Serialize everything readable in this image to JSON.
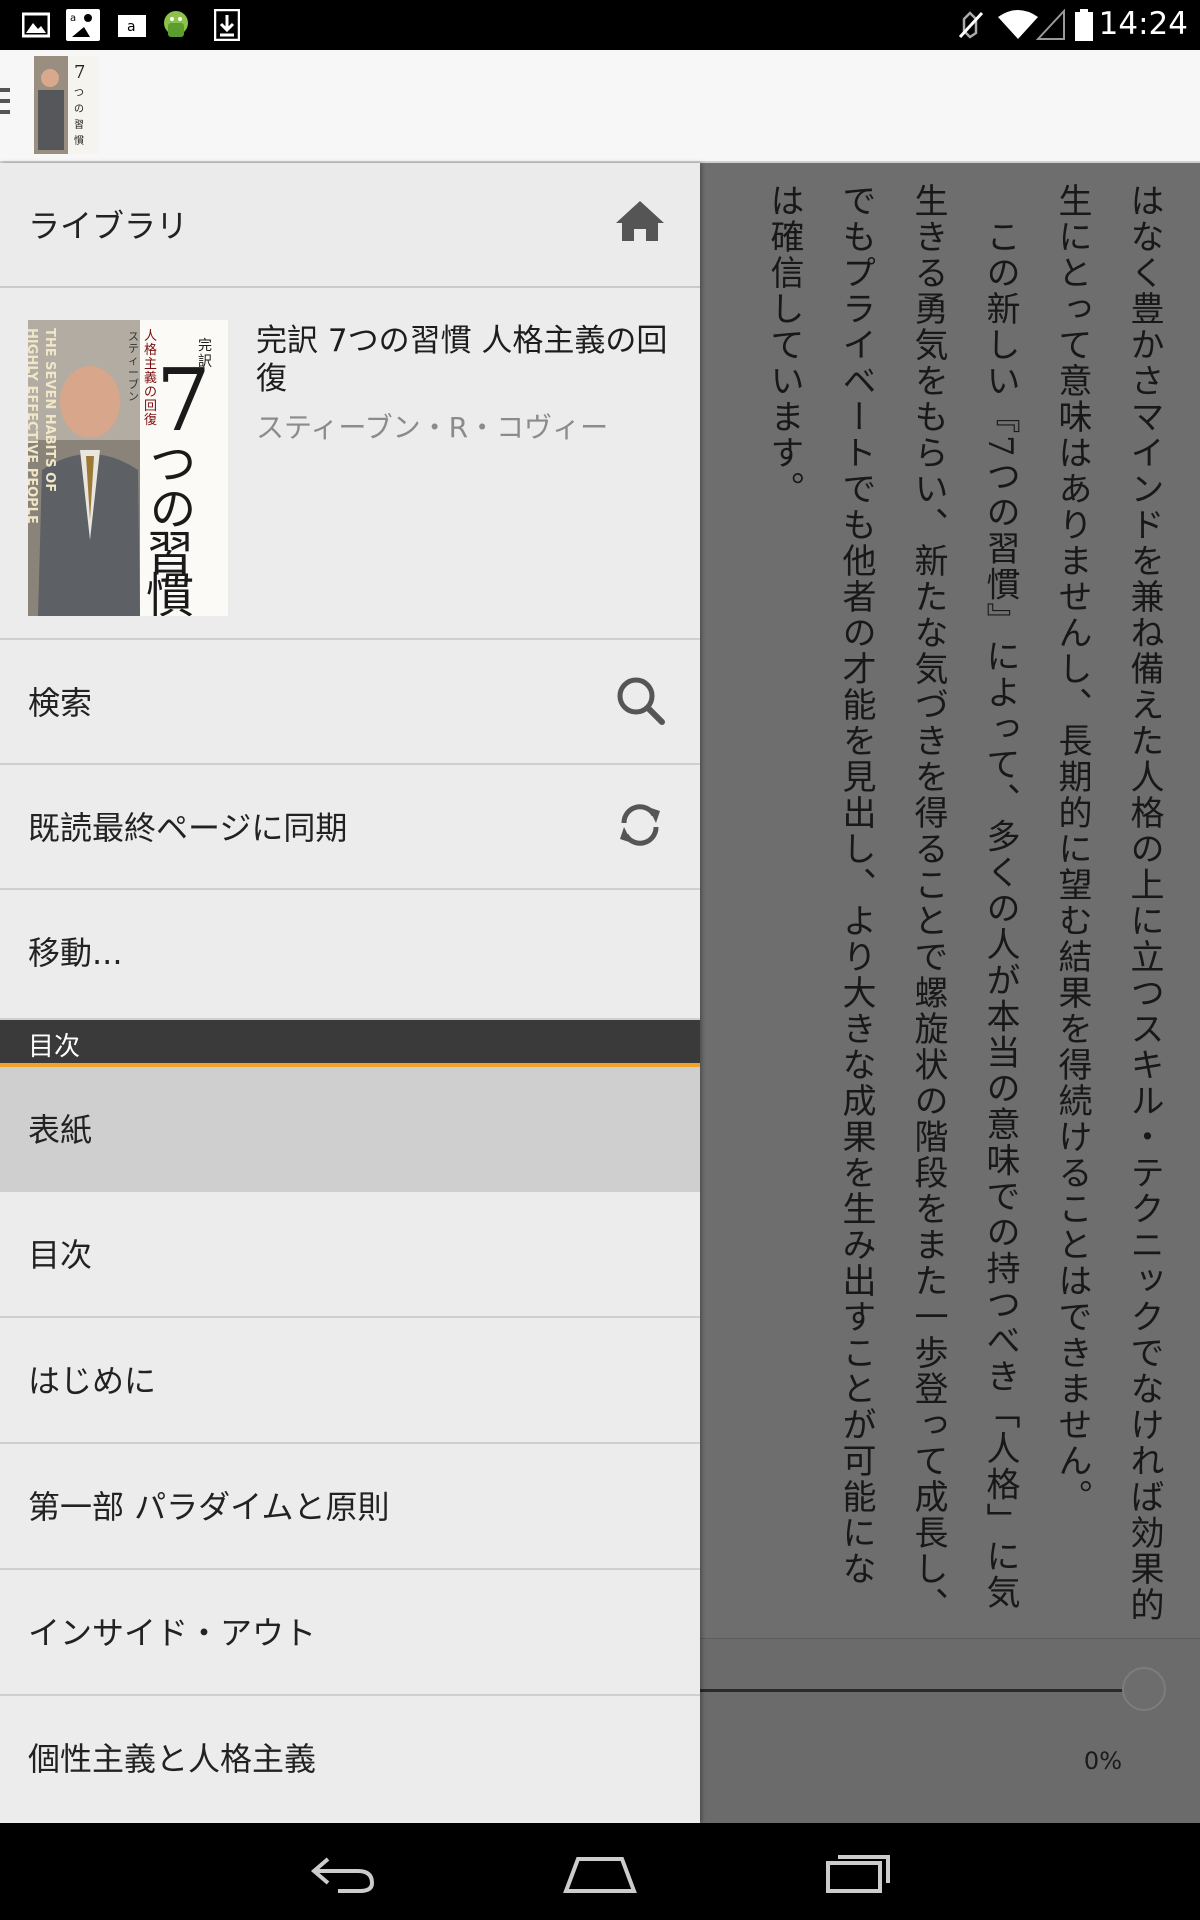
{
  "status_bar": {
    "time": "14:24",
    "left_icons": [
      "gallery-icon",
      "kindle-reader-icon",
      "amazon-store-icon",
      "android-icon",
      "download-icon"
    ],
    "right_icons": [
      "mute-icon",
      "wifi-icon",
      "signal-icon",
      "battery-icon"
    ]
  },
  "action_bar": {
    "icons": [
      "menu-icon",
      "book-thumbnail"
    ]
  },
  "drawer": {
    "library": {
      "label": "ライブラリ",
      "icon": "home-icon"
    },
    "book": {
      "title": "完訳 7つの習慣 人格主義の回復",
      "author": "スティーブン・R・コヴィー",
      "cover": {
        "badge": "完訳",
        "number": "7",
        "title_text": "つの習慣",
        "subtitle": "人格主義の回復",
        "author_line": "スティーブン・R・コヴィー",
        "english_title": "THE SEVEN HABITS OF HIGHLY EFFECTIVE PEOPLE"
      }
    },
    "search": {
      "label": "検索",
      "icon": "search-icon"
    },
    "sync": {
      "label": "既読最終ページに同期",
      "icon": "sync-icon"
    },
    "goto": {
      "label": "移動..."
    },
    "toc_header": "目次",
    "toc_items": [
      {
        "label": "表紙",
        "selected": true
      },
      {
        "label": "目次",
        "selected": false
      },
      {
        "label": "はじめに",
        "selected": false
      },
      {
        "label": "第一部 パラダイムと原則",
        "selected": false
      },
      {
        "label": "インサイド・アウト",
        "selected": false
      },
      {
        "label": "個性主義と人格主義",
        "selected": false
      }
    ]
  },
  "reader": {
    "columns": [
      "はなく豊かさマインドを兼ね備えた人格の上に立つスキル・テクニックでなければ効果的",
      "生にとって意味はありませんし、長期的に望む結果を得続けることはできません。",
      "　この新しい『7つの習慣』によって、多くの人が本当の意味での持つべき「人格」に気",
      "生きる勇気をもらい、新たな気づきを得ることで螺旋状の階段をまた一歩登って成長し、",
      "でもプライベートでも他者の才能を見出し、より大きな成果を生み出すことが可能にな",
      "は確信しています。"
    ],
    "progress_label": "0%",
    "progress_value": 0
  },
  "nav_bar": {
    "icons": [
      "back-icon",
      "home-icon",
      "recent-apps-icon"
    ]
  }
}
